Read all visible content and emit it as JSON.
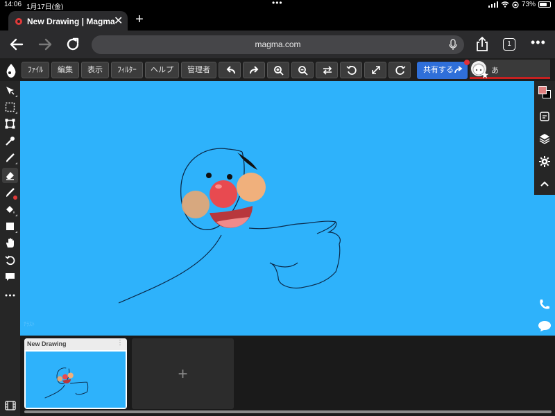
{
  "status_bar": {
    "time": "14:06",
    "date": "1月17日(金)",
    "battery": "73%",
    "battery_level": 0.73
  },
  "browser": {
    "tab_title": "New Drawing | Magma",
    "url": "magma.com",
    "tab_count": "1"
  },
  "toolbar": {
    "menus": [
      "ﾌｧｲﾙ",
      "編集",
      "表示",
      "ﾌｨﾙﾀｰ",
      "ヘルプ",
      "管理者"
    ],
    "share_label": "共有する",
    "user_name": "あ"
  },
  "colors": {
    "canvas_bg": "#2eb2fb",
    "primary_color": "#e08080",
    "secondary_color": "#000000",
    "share_button": "#2f6fd9",
    "user_bar": "#c62020"
  },
  "left_tools": [
    "move-icon",
    "selection-icon",
    "transform-icon",
    "eyedropper-icon",
    "brush-icon",
    "eraser-icon",
    "smudge-icon",
    "bucket-icon",
    "shape-icon",
    "hand-icon",
    "rotate-icon",
    "comment-icon",
    "more-icon"
  ],
  "canvas": {
    "watermark": "ﾅﾗｽﾄ"
  },
  "documents": {
    "items": [
      {
        "name": "New Drawing"
      }
    ],
    "add_label": "+"
  }
}
